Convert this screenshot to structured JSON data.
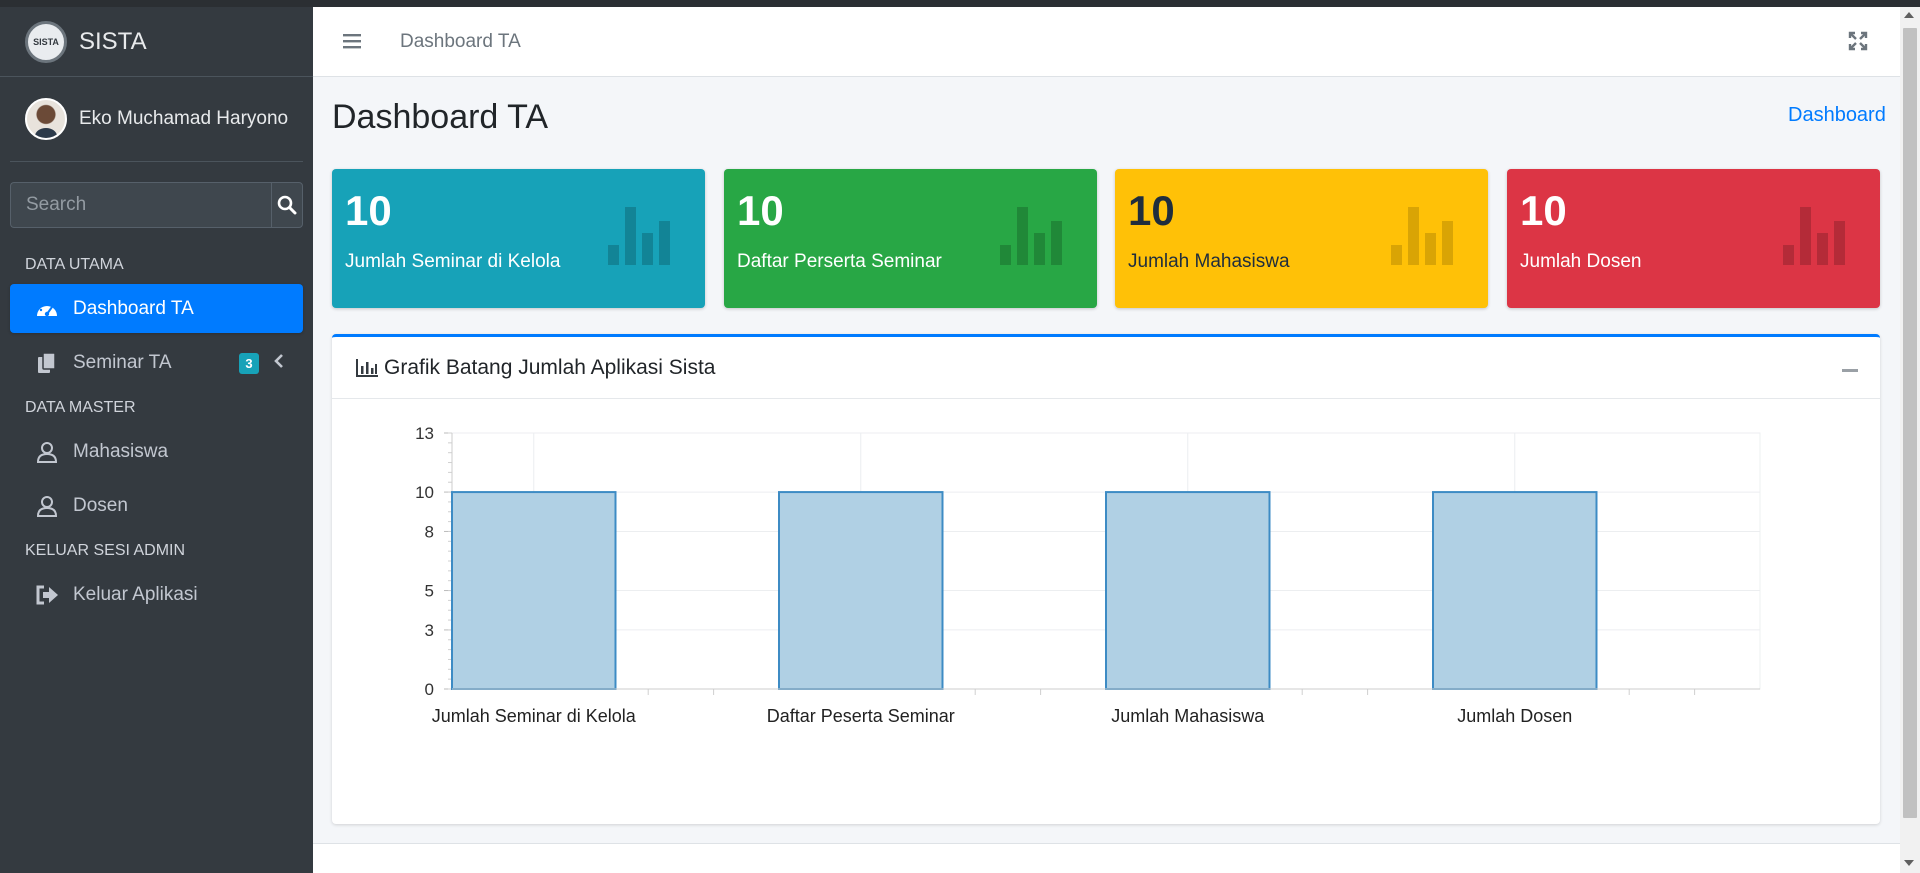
{
  "brand": {
    "name": "SISTA",
    "logo_text": "SISTA"
  },
  "user": {
    "name": "Eko Muchamad Haryono"
  },
  "search": {
    "placeholder": "Search"
  },
  "sidebar": {
    "headers": [
      "DATA UTAMA",
      "DATA MASTER",
      "KELUAR SESI ADMIN"
    ],
    "items": [
      {
        "label": "Dashboard TA",
        "icon": "tachometer-icon",
        "active": true
      },
      {
        "label": "Seminar TA",
        "icon": "copy-icon",
        "badge": "3"
      },
      {
        "label": "Mahasiswa",
        "icon": "user-icon"
      },
      {
        "label": "Dosen",
        "icon": "user-icon"
      },
      {
        "label": "Keluar Aplikasi",
        "icon": "sign-out-icon"
      }
    ]
  },
  "navbar": {
    "home_link": "Dashboard TA"
  },
  "page": {
    "title": "Dashboard TA",
    "breadcrumb": "Dashboard"
  },
  "stats": [
    {
      "value": "10",
      "label": "Jumlah Seminar di Kelola",
      "color": "#17a2b8"
    },
    {
      "value": "10",
      "label": "Daftar Perserta Seminar",
      "color": "#28a745"
    },
    {
      "value": "10",
      "label": "Jumlah Mahasiswa",
      "color": "#ffc107"
    },
    {
      "value": "10",
      "label": "Jumlah Dosen",
      "color": "#dc3545"
    }
  ],
  "card": {
    "title": "Grafik Batang Jumlah Aplikasi Sista"
  },
  "chart_data": {
    "type": "bar",
    "categories": [
      "Jumlah Seminar di Kelola",
      "Daftar Peserta Seminar",
      "Jumlah Mahasiswa",
      "Jumlah Dosen"
    ],
    "values": [
      10,
      10,
      10,
      10
    ],
    "ylim": [
      0,
      13
    ],
    "yticks": [
      "0",
      "3",
      "5",
      "8",
      "10",
      "13"
    ],
    "grid": true,
    "bar_fill": "#b0d0e4",
    "bar_stroke": "#3d8bc4"
  }
}
